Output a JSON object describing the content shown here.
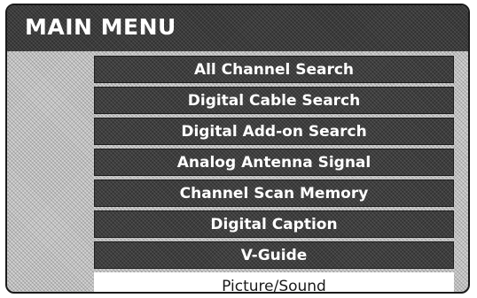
{
  "menu": {
    "title": "MAIN MENU",
    "items": [
      {
        "label": "All Channel Search"
      },
      {
        "label": "Digital Cable Search"
      },
      {
        "label": "Digital Add-on Search"
      },
      {
        "label": "Analog Antenna Signal"
      },
      {
        "label": "Channel Scan Memory"
      },
      {
        "label": "Digital Caption"
      },
      {
        "label": "V-Guide"
      },
      {
        "label": "Picture/Sound"
      }
    ],
    "selected_item": "Picture/Sound"
  }
}
